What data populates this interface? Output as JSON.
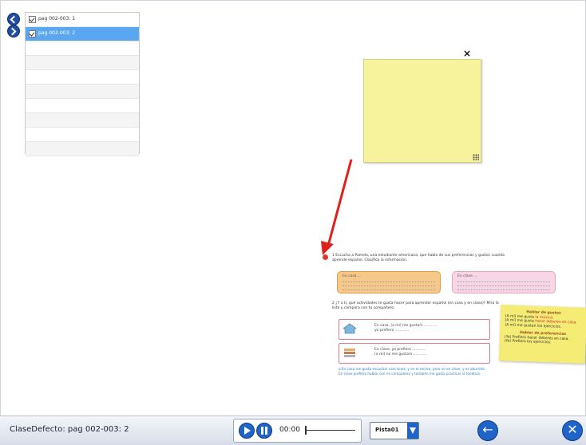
{
  "pages": {
    "items": [
      {
        "label": "pag 002-003: 1",
        "checked": true,
        "selected": false
      },
      {
        "label": "pag 002-003: 2",
        "checked": true,
        "selected": true
      }
    ]
  },
  "sticky_note": {
    "close_symbol": "×"
  },
  "book": {
    "ex1_text": "1 Escucha a Pamela, una estudiante americana, que habla de sus preferencias y gustos cuando aprende español. Clasifica la información.",
    "pill_left_head": "En casa ...",
    "pill_right_head": "En clase ...",
    "ex2_text": "2 ¿Y a ti, qué actividades te gusta hacer para aprender español (en casa y en clase)? Mira la lista y compara con tu compañero.",
    "box1_lines": [
      "En casa, (a mí) me gusta/n ............",
      "yo prefiero ............"
    ],
    "box2_lines": [
      "En clase, yo prefiero ............",
      "(a mí) no me gusta/n ............"
    ],
    "card": {
      "title1": "Hablar de gustos",
      "rows1": [
        {
          "pre": "(A mí) me gusta ",
          "hl": "la música."
        },
        {
          "pre": "(A mí) me gusta ",
          "hl": "hacer deberes en casa."
        },
        {
          "pre": "(A mí) me gustan los ejercicios.",
          "hl": ""
        }
      ],
      "title2": "Hablar de preferencias",
      "rows2": [
        "(Yo) Prefiero hacer deberes en casa.",
        "(Yo) Prefiero los ejercicios."
      ]
    },
    "footnote": "a En casa me gusta escuchar canciones, y en el recreo, pero no en clase, y es aburrido. En clase prefiero hablar con mi compañero y también me gusta practicar la fonética."
  },
  "bottom_bar": {
    "status": "ClaseDefecto: pag 002-003: 2",
    "time": "00:00",
    "progress": 0,
    "track": "Pista01"
  },
  "colors": {
    "accent": "#1f64c8",
    "selected_row": "#59a7f0",
    "sticky": "#f6f39c",
    "arrow": "#e0201a"
  }
}
